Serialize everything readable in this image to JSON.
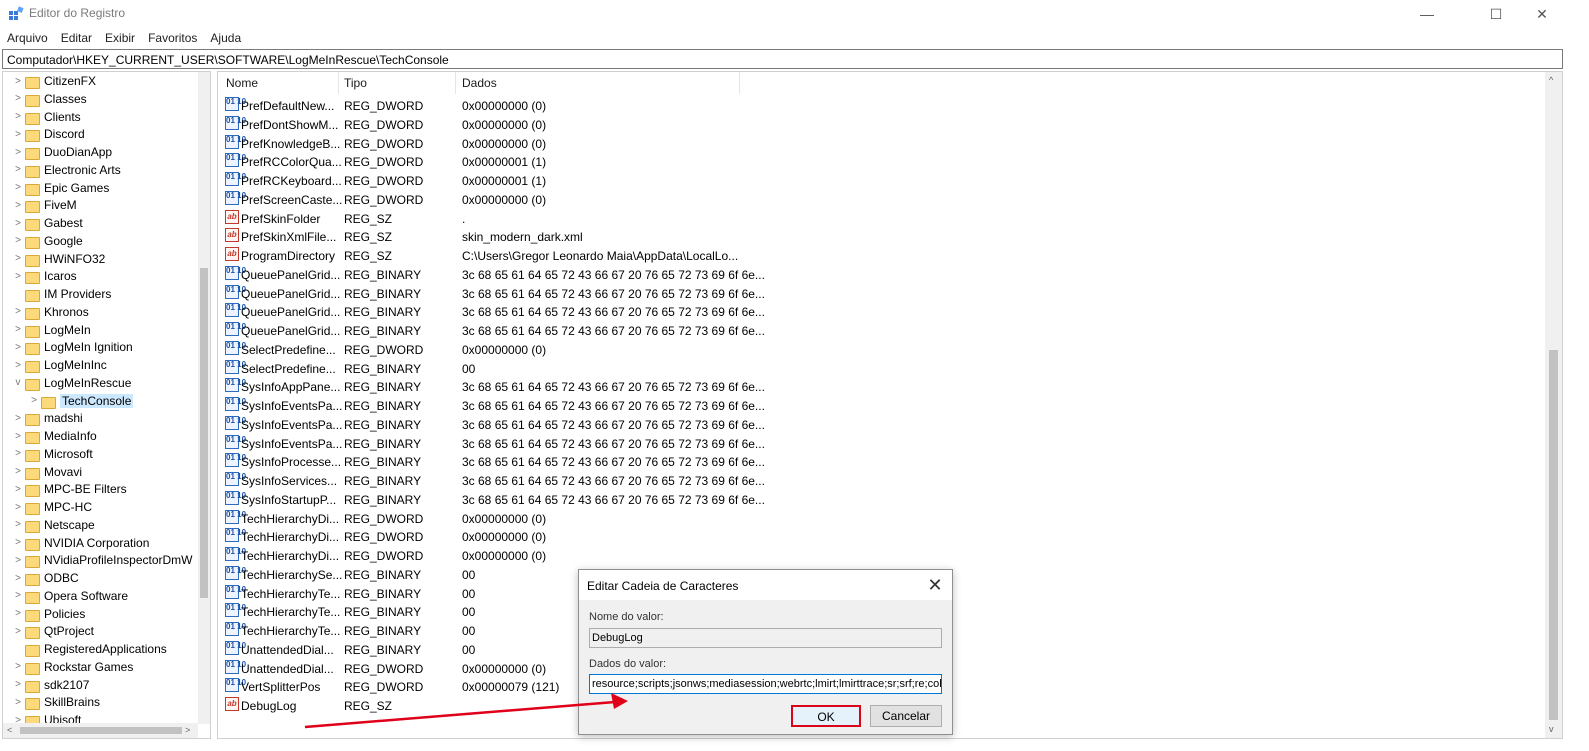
{
  "window": {
    "title": "Editor do Registro",
    "controls": {
      "minimize": "—",
      "maximize": "☐",
      "close": "✕"
    }
  },
  "menu": [
    "Arquivo",
    "Editar",
    "Exibir",
    "Favoritos",
    "Ajuda"
  ],
  "address": "Computador\\HKEY_CURRENT_USER\\SOFTWARE\\LogMeInRescue\\TechConsole",
  "tree": {
    "items": [
      {
        "label": "CitizenFX",
        "arrow": ">"
      },
      {
        "label": "Classes",
        "arrow": ">"
      },
      {
        "label": "Clients",
        "arrow": ">"
      },
      {
        "label": "Discord",
        "arrow": ">"
      },
      {
        "label": "DuoDianApp",
        "arrow": ">"
      },
      {
        "label": "Electronic Arts",
        "arrow": ">"
      },
      {
        "label": "Epic Games",
        "arrow": ">"
      },
      {
        "label": "FiveM",
        "arrow": ">"
      },
      {
        "label": "Gabest",
        "arrow": ">"
      },
      {
        "label": "Google",
        "arrow": ">"
      },
      {
        "label": "HWiNFO32",
        "arrow": ">"
      },
      {
        "label": "Icaros",
        "arrow": ">"
      },
      {
        "label": "IM Providers",
        "arrow": ""
      },
      {
        "label": "Khronos",
        "arrow": ">"
      },
      {
        "label": "LogMeIn",
        "arrow": ">"
      },
      {
        "label": "LogMeIn Ignition",
        "arrow": ">"
      },
      {
        "label": "LogMeInInc",
        "arrow": ">"
      },
      {
        "label": "LogMeInRescue",
        "arrow": "v"
      },
      {
        "label": "TechConsole",
        "arrow": ">",
        "child": true,
        "selected": true
      },
      {
        "label": "madshi",
        "arrow": ">"
      },
      {
        "label": "MediaInfo",
        "arrow": ">"
      },
      {
        "label": "Microsoft",
        "arrow": ">"
      },
      {
        "label": "Movavi",
        "arrow": ">"
      },
      {
        "label": "MPC-BE Filters",
        "arrow": ">"
      },
      {
        "label": "MPC-HC",
        "arrow": ">"
      },
      {
        "label": "Netscape",
        "arrow": ">"
      },
      {
        "label": "NVIDIA Corporation",
        "arrow": ">"
      },
      {
        "label": "NVidiaProfileInspectorDmW",
        "arrow": ">"
      },
      {
        "label": "ODBC",
        "arrow": ">"
      },
      {
        "label": "Opera Software",
        "arrow": ">"
      },
      {
        "label": "Policies",
        "arrow": ">"
      },
      {
        "label": "QtProject",
        "arrow": ">"
      },
      {
        "label": "RegisteredApplications",
        "arrow": ""
      },
      {
        "label": "Rockstar Games",
        "arrow": ">"
      },
      {
        "label": "sdk2107",
        "arrow": ">"
      },
      {
        "label": "SkillBrains",
        "arrow": ">"
      },
      {
        "label": "Ubisoft",
        "arrow": ">"
      }
    ]
  },
  "list": {
    "columns": [
      "Nome",
      "Tipo",
      "Dados"
    ],
    "rows": [
      {
        "name": "PrefDefaultNew...",
        "type": "REG_DWORD",
        "data": "0x00000000 (0)",
        "icon": "bin"
      },
      {
        "name": "PrefDontShowM...",
        "type": "REG_DWORD",
        "data": "0x00000000 (0)",
        "icon": "bin"
      },
      {
        "name": "PrefKnowledgeB...",
        "type": "REG_DWORD",
        "data": "0x00000000 (0)",
        "icon": "bin"
      },
      {
        "name": "PrefRCColorQua...",
        "type": "REG_DWORD",
        "data": "0x00000001 (1)",
        "icon": "bin"
      },
      {
        "name": "PrefRCKeyboard...",
        "type": "REG_DWORD",
        "data": "0x00000001 (1)",
        "icon": "bin"
      },
      {
        "name": "PrefScreenCaste...",
        "type": "REG_DWORD",
        "data": "0x00000000 (0)",
        "icon": "bin"
      },
      {
        "name": "PrefSkinFolder",
        "type": "REG_SZ",
        "data": ".",
        "icon": "sz"
      },
      {
        "name": "PrefSkinXmlFile...",
        "type": "REG_SZ",
        "data": "skin_modern_dark.xml",
        "icon": "sz"
      },
      {
        "name": "ProgramDirectory",
        "type": "REG_SZ",
        "data": "C:\\Users\\Gregor Leonardo Maia\\AppData\\LocalLo...",
        "icon": "sz"
      },
      {
        "name": "QueuePanelGrid...",
        "type": "REG_BINARY",
        "data": "3c 68 65 61 64 65 72 43 66 67 20 76 65 72 73 69 6f 6e...",
        "icon": "bin"
      },
      {
        "name": "QueuePanelGrid...",
        "type": "REG_BINARY",
        "data": "3c 68 65 61 64 65 72 43 66 67 20 76 65 72 73 69 6f 6e...",
        "icon": "bin"
      },
      {
        "name": "QueuePanelGrid...",
        "type": "REG_BINARY",
        "data": "3c 68 65 61 64 65 72 43 66 67 20 76 65 72 73 69 6f 6e...",
        "icon": "bin"
      },
      {
        "name": "QueuePanelGrid...",
        "type": "REG_BINARY",
        "data": "3c 68 65 61 64 65 72 43 66 67 20 76 65 72 73 69 6f 6e...",
        "icon": "bin"
      },
      {
        "name": "SelectPredefine...",
        "type": "REG_DWORD",
        "data": "0x00000000 (0)",
        "icon": "bin"
      },
      {
        "name": "SelectPredefine...",
        "type": "REG_BINARY",
        "data": "00",
        "icon": "bin"
      },
      {
        "name": "SysInfoAppPane...",
        "type": "REG_BINARY",
        "data": "3c 68 65 61 64 65 72 43 66 67 20 76 65 72 73 69 6f 6e...",
        "icon": "bin"
      },
      {
        "name": "SysInfoEventsPa...",
        "type": "REG_BINARY",
        "data": "3c 68 65 61 64 65 72 43 66 67 20 76 65 72 73 69 6f 6e...",
        "icon": "bin"
      },
      {
        "name": "SysInfoEventsPa...",
        "type": "REG_BINARY",
        "data": "3c 68 65 61 64 65 72 43 66 67 20 76 65 72 73 69 6f 6e...",
        "icon": "bin"
      },
      {
        "name": "SysInfoEventsPa...",
        "type": "REG_BINARY",
        "data": "3c 68 65 61 64 65 72 43 66 67 20 76 65 72 73 69 6f 6e...",
        "icon": "bin"
      },
      {
        "name": "SysInfoProcesse...",
        "type": "REG_BINARY",
        "data": "3c 68 65 61 64 65 72 43 66 67 20 76 65 72 73 69 6f 6e...",
        "icon": "bin"
      },
      {
        "name": "SysInfoServices...",
        "type": "REG_BINARY",
        "data": "3c 68 65 61 64 65 72 43 66 67 20 76 65 72 73 69 6f 6e...",
        "icon": "bin"
      },
      {
        "name": "SysInfoStartupP...",
        "type": "REG_BINARY",
        "data": "3c 68 65 61 64 65 72 43 66 67 20 76 65 72 73 69 6f 6e...",
        "icon": "bin"
      },
      {
        "name": "TechHierarchyDi...",
        "type": "REG_DWORD",
        "data": "0x00000000 (0)",
        "icon": "bin"
      },
      {
        "name": "TechHierarchyDi...",
        "type": "REG_DWORD",
        "data": "0x00000000 (0)",
        "icon": "bin"
      },
      {
        "name": "TechHierarchyDi...",
        "type": "REG_DWORD",
        "data": "0x00000000 (0)",
        "icon": "bin"
      },
      {
        "name": "TechHierarchySe...",
        "type": "REG_BINARY",
        "data": "00",
        "icon": "bin"
      },
      {
        "name": "TechHierarchyTe...",
        "type": "REG_BINARY",
        "data": "00",
        "icon": "bin"
      },
      {
        "name": "TechHierarchyTe...",
        "type": "REG_BINARY",
        "data": "00",
        "icon": "bin"
      },
      {
        "name": "TechHierarchyTe...",
        "type": "REG_BINARY",
        "data": "00",
        "icon": "bin"
      },
      {
        "name": "UnattendedDial...",
        "type": "REG_BINARY",
        "data": "00",
        "icon": "bin"
      },
      {
        "name": "UnattendedDial...",
        "type": "REG_DWORD",
        "data": "0x00000000 (0)",
        "icon": "bin"
      },
      {
        "name": "VertSplitterPos",
        "type": "REG_DWORD",
        "data": "0x00000079 (121)",
        "icon": "bin"
      },
      {
        "name": "DebugLog",
        "type": "REG_SZ",
        "data": "",
        "icon": "sz"
      }
    ]
  },
  "dialog": {
    "title": "Editar Cadeia de Caracteres",
    "close": "✕",
    "name_label": "Nome do valor:",
    "name_value": "DebugLog",
    "data_label": "Dados do valor:",
    "data_value": "resource;scripts;jsonws;mediasession;webrtc;lmirt;lmirttrace;sr;srf;re;col;mqtt",
    "ok": "OK",
    "cancel": "Cancelar"
  },
  "annotation_color": "#e0001a"
}
